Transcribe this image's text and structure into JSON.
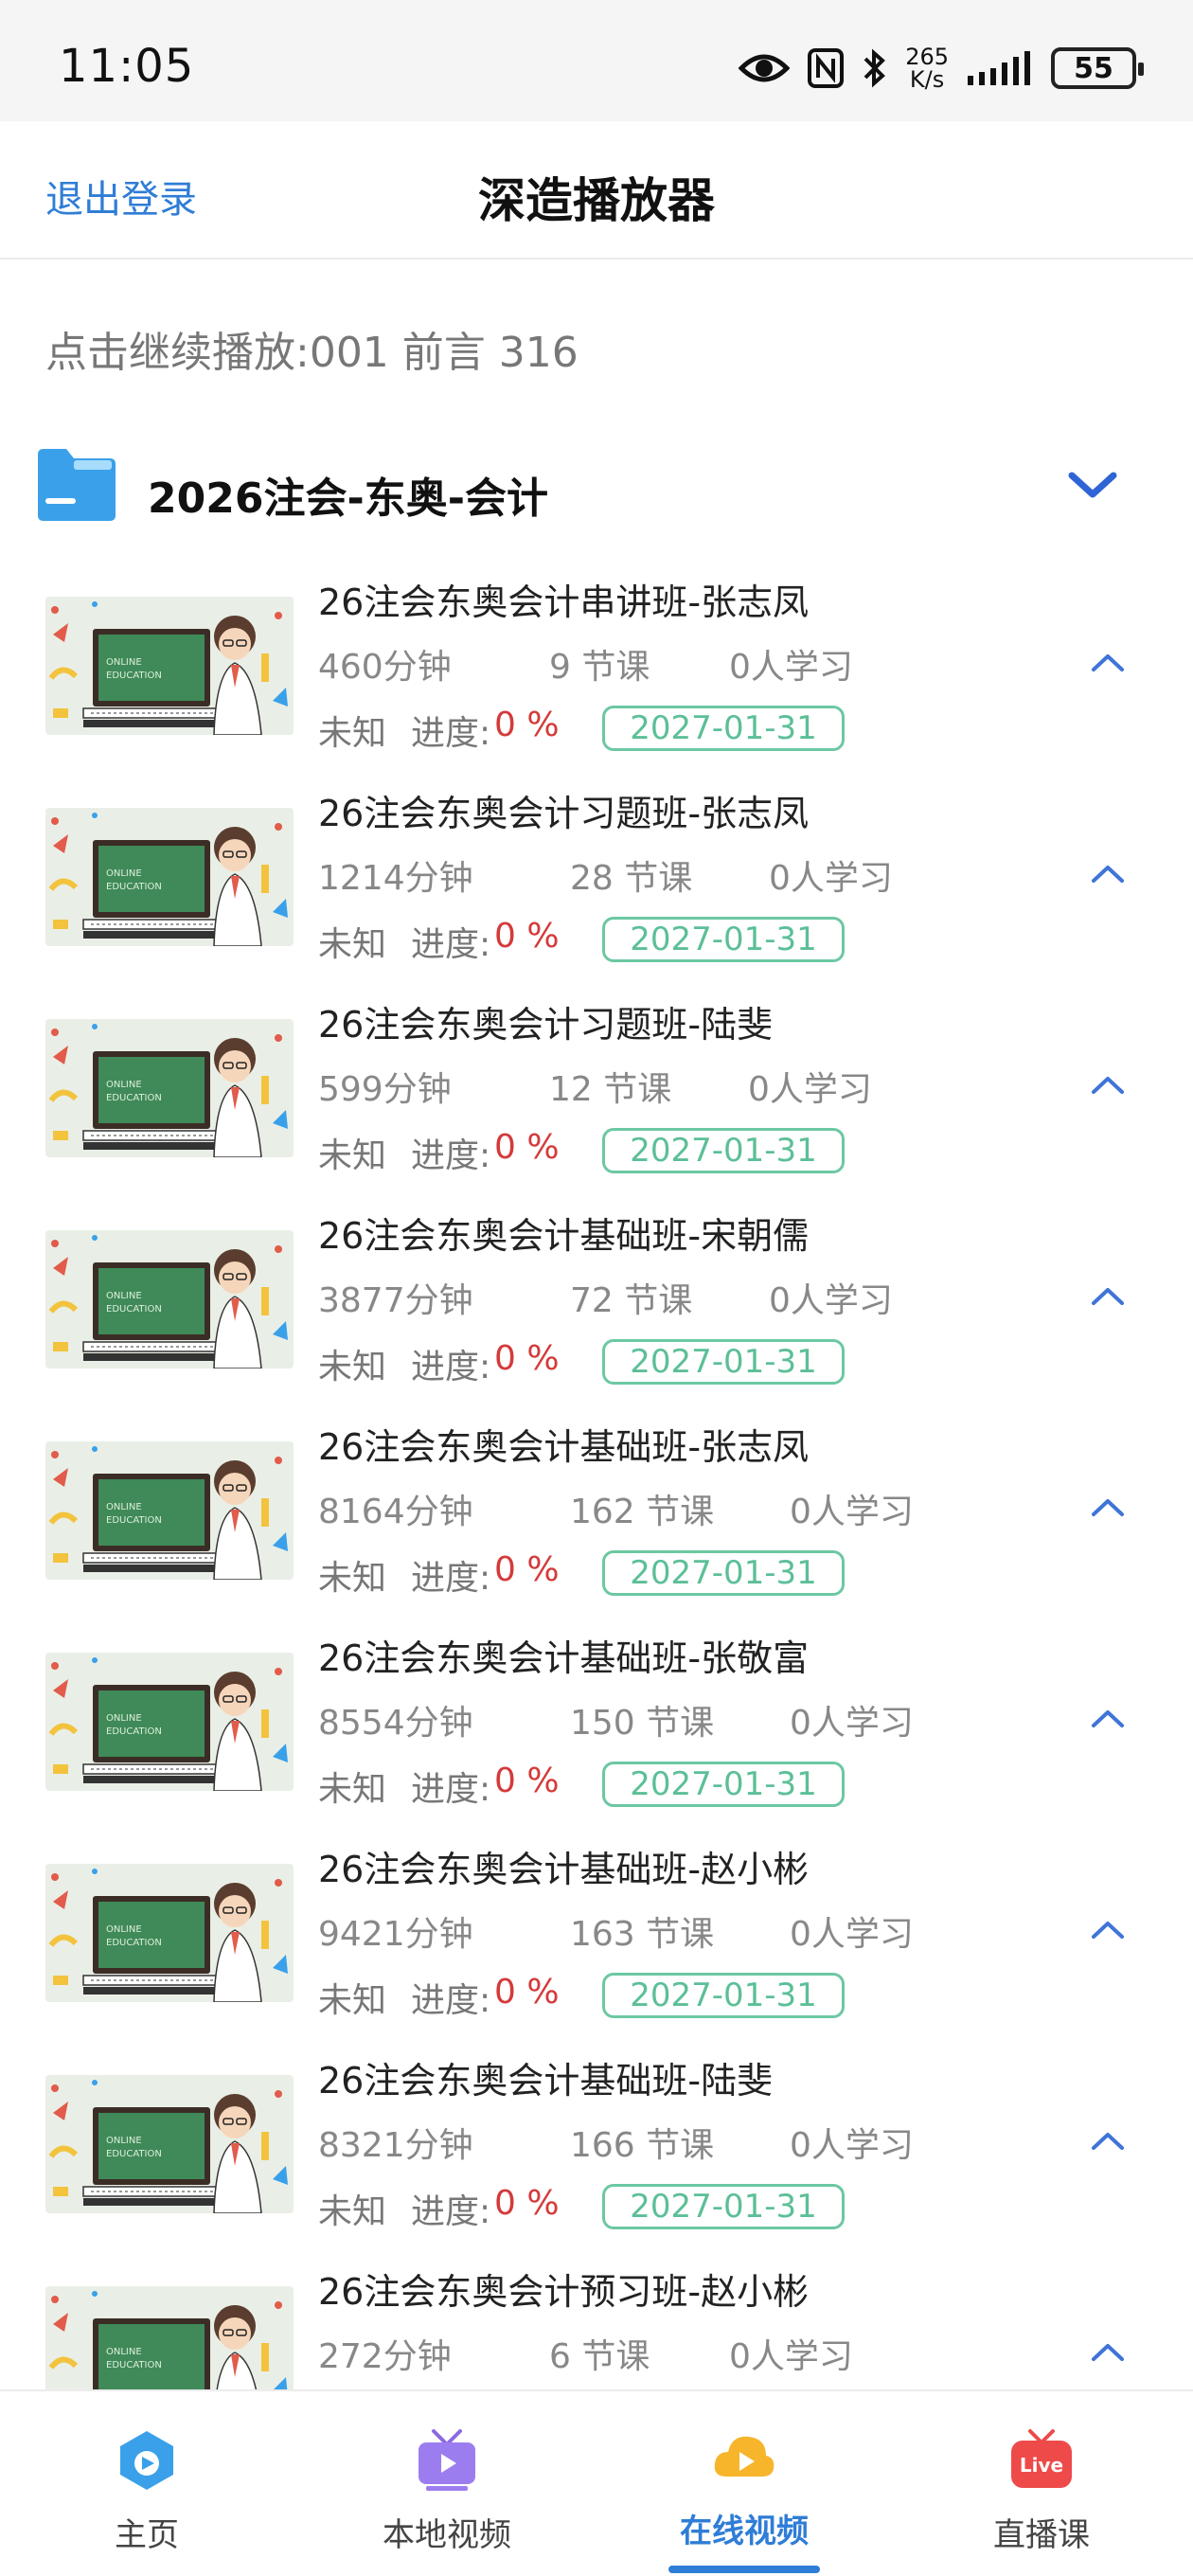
{
  "status_bar": {
    "time": "11:05",
    "network_speed_value": "265",
    "network_speed_unit": "K/s",
    "battery": "55",
    "icons": [
      "eye-icon",
      "nfc-icon",
      "bluetooth-icon",
      "signal-icon",
      "battery-icon"
    ]
  },
  "header": {
    "logout_label": "退出登录",
    "title": "深造播放器"
  },
  "continue_text": "点击继续播放:001 前言 316",
  "folder": {
    "name": "2026注会-东奥-会计",
    "expanded": true,
    "icon": "folder-icon"
  },
  "courses": [
    {
      "title": "26注会东奥会计串讲班-张志凤",
      "minutes": "460分钟",
      "lessons": "9 节课",
      "students": "0人学习",
      "status": "未知",
      "progress_label": "进度:",
      "progress": "0 %",
      "expiry": "2027-01-31"
    },
    {
      "title": "26注会东奥会计习题班-张志凤",
      "minutes": "1214分钟",
      "lessons": "28 节课",
      "students": "0人学习",
      "status": "未知",
      "progress_label": "进度:",
      "progress": "0 %",
      "expiry": "2027-01-31"
    },
    {
      "title": "26注会东奥会计习题班-陆斐",
      "minutes": "599分钟",
      "lessons": "12 节课",
      "students": "0人学习",
      "status": "未知",
      "progress_label": "进度:",
      "progress": "0 %",
      "expiry": "2027-01-31"
    },
    {
      "title": "26注会东奥会计基础班-宋朝儒",
      "minutes": "3877分钟",
      "lessons": "72 节课",
      "students": "0人学习",
      "status": "未知",
      "progress_label": "进度:",
      "progress": "0 %",
      "expiry": "2027-01-31"
    },
    {
      "title": "26注会东奥会计基础班-张志凤",
      "minutes": "8164分钟",
      "lessons": "162 节课",
      "students": "0人学习",
      "status": "未知",
      "progress_label": "进度:",
      "progress": "0 %",
      "expiry": "2027-01-31"
    },
    {
      "title": "26注会东奥会计基础班-张敬富",
      "minutes": "8554分钟",
      "lessons": "150 节课",
      "students": "0人学习",
      "status": "未知",
      "progress_label": "进度:",
      "progress": "0 %",
      "expiry": "2027-01-31"
    },
    {
      "title": "26注会东奥会计基础班-赵小彬",
      "minutes": "9421分钟",
      "lessons": "163 节课",
      "students": "0人学习",
      "status": "未知",
      "progress_label": "进度:",
      "progress": "0 %",
      "expiry": "2027-01-31"
    },
    {
      "title": "26注会东奥会计基础班-陆斐",
      "minutes": "8321分钟",
      "lessons": "166 节课",
      "students": "0人学习",
      "status": "未知",
      "progress_label": "进度:",
      "progress": "0 %",
      "expiry": "2027-01-31"
    },
    {
      "title": "26注会东奥会计预习班-赵小彬",
      "minutes": "272分钟",
      "lessons": "6 节课",
      "students": "0人学习",
      "status": "",
      "progress_label": "",
      "progress": "",
      "expiry": ""
    }
  ],
  "thumbnail_text": {
    "line1": "ONLINE",
    "line2": "EDUCATION"
  },
  "bottom_nav": [
    {
      "label": "主页",
      "icon": "home-icon",
      "active": false
    },
    {
      "label": "本地视频",
      "icon": "local-video-icon",
      "active": false
    },
    {
      "label": "在线视频",
      "icon": "online-video-icon",
      "active": true
    },
    {
      "label": "直播课",
      "icon": "live-icon",
      "active": false,
      "badge": "Live"
    }
  ],
  "colors": {
    "accent": "#2f7dd6",
    "progress_red": "#d43a3a",
    "date_green": "#5cbf97",
    "folder_blue": "#3aa0ea"
  }
}
